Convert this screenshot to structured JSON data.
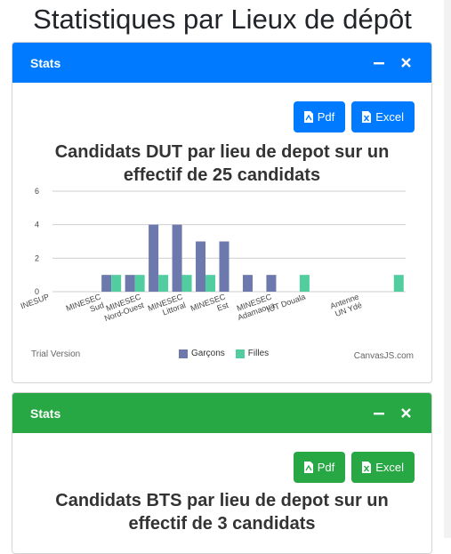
{
  "page": {
    "title": "Statistiques par Lieux de dépôt"
  },
  "colors": {
    "primary": "#007bff",
    "success": "#28a745",
    "garcons": "#6d78ad",
    "filles": "#51cda0"
  },
  "cards": [
    {
      "header": "Stats",
      "pdf_label": "Pdf",
      "excel_label": "Excel",
      "chart_title_line1": "Candidats DUT par lieu de depot sur un",
      "chart_title_line2": "effectif de 25 candidats",
      "trial_text": "Trial Version",
      "credit_text": "CanvasJS.com"
    },
    {
      "header": "Stats",
      "pdf_label": "Pdf",
      "excel_label": "Excel",
      "chart_title_line1": "Candidats BTS par lieu de depot sur un",
      "chart_title_line2": "effectif de 3 candidats"
    }
  ],
  "chart_data": {
    "type": "bar",
    "title": "Candidats DUT par lieu de depot sur un effectif de 25 candidats",
    "categories": [
      "MINESUP",
      "MINESEC Sud",
      "MINESEC Nord-Ouest",
      "MINESEC Littoral",
      "MINESEC Est",
      "MINESEC Adamaoua",
      "IUT Douala",
      "Antenne UN Ydé"
    ],
    "visible_tick_labels": [
      [
        "INESUP"
      ],
      [
        "MINESEC",
        "Sud"
      ],
      [
        "MINESEC",
        "Nord-Ouest"
      ],
      [
        "MINESEC",
        "Littoral"
      ],
      [
        "MINESEC",
        "Est"
      ],
      [
        "MINESEC",
        "Adamaoua"
      ],
      [
        "IUT Douala"
      ],
      [
        "Antenne",
        "UN Ydé"
      ]
    ],
    "series": [
      {
        "name": "Garçons",
        "values": [
          0,
          0,
          1,
          1,
          4,
          4,
          3,
          3,
          1,
          1,
          0,
          0,
          0,
          0,
          0
        ]
      },
      {
        "name": "Filles",
        "values": [
          0,
          0,
          1,
          1,
          1,
          1,
          1,
          0,
          0,
          0,
          1,
          0,
          0,
          0,
          1
        ]
      }
    ],
    "yticks": [
      0,
      2,
      4,
      6
    ],
    "ylim": [
      0,
      6
    ],
    "grid": true,
    "legend": "bottom-center"
  }
}
